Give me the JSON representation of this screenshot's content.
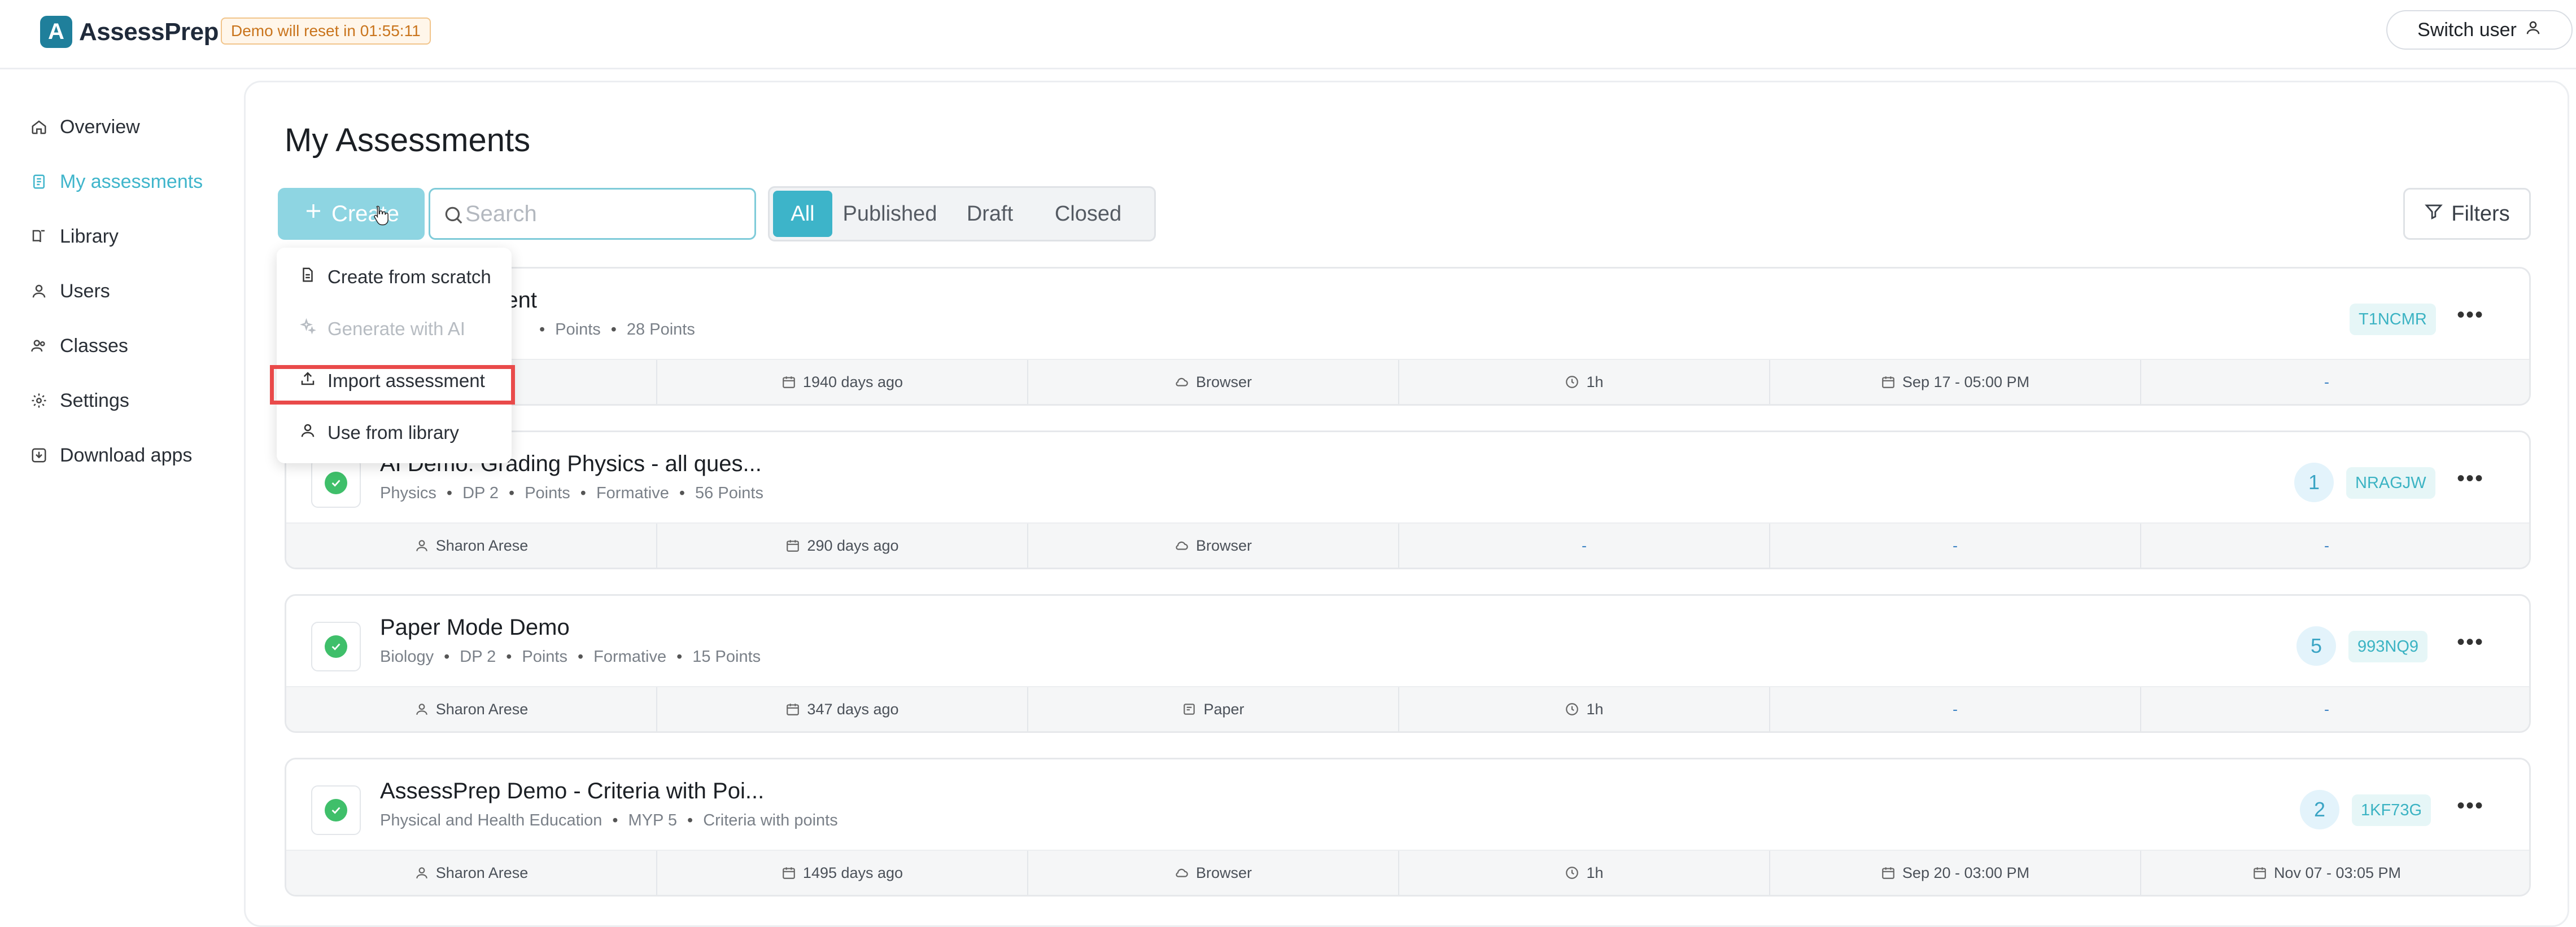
{
  "app": {
    "logo_mark": "A",
    "logo_text": "AssessPrep",
    "demo_badge": "Demo will reset in 01:55:11",
    "switch_user": "Switch user"
  },
  "sidebar": {
    "items": [
      {
        "label": "Overview",
        "icon": "home-icon"
      },
      {
        "label": "My assessments",
        "icon": "document-icon",
        "active": true
      },
      {
        "label": "Library",
        "icon": "book-icon"
      },
      {
        "label": "Users",
        "icon": "user-icon"
      },
      {
        "label": "Classes",
        "icon": "people-icon"
      },
      {
        "label": "Settings",
        "icon": "gear-icon"
      },
      {
        "label": "Download apps",
        "icon": "download-icon"
      }
    ]
  },
  "main": {
    "title": "My Assessments",
    "create_label": "Create",
    "search_placeholder": "Search",
    "tabs": [
      {
        "label": "All",
        "active": true
      },
      {
        "label": "Published"
      },
      {
        "label": "Draft"
      },
      {
        "label": "Closed"
      }
    ],
    "filters_label": "Filters"
  },
  "dropdown": {
    "items": [
      {
        "label": "Create from scratch",
        "icon": "file-icon"
      },
      {
        "label": "Generate with AI",
        "icon": "sparkle-icon",
        "disabled": true
      },
      {
        "label": "Import assessment",
        "icon": "upload-icon",
        "highlighted": true
      },
      {
        "label": "Use from library",
        "icon": "user-icon"
      }
    ]
  },
  "assessments": [
    {
      "title": "sment",
      "meta": [
        "Points",
        "28 Points"
      ],
      "count": "",
      "code": "T1NCMR",
      "footer": [
        "se",
        "1940 days ago",
        "Browser",
        "1h",
        "Sep 17 - 05:00 PM",
        "-"
      ]
    },
    {
      "title": "AI Demo: Grading Physics - all ques...",
      "meta": [
        "Physics",
        "DP 2",
        "Points",
        "Formative",
        "56 Points"
      ],
      "count": "1",
      "code": "NRAGJW",
      "footer": [
        "Sharon Arese",
        "290 days ago",
        "Browser",
        "-",
        "-",
        "-"
      ]
    },
    {
      "title": "Paper Mode Demo",
      "meta": [
        "Biology",
        "DP 2",
        "Points",
        "Formative",
        "15 Points"
      ],
      "count": "5",
      "code": "993NQ9",
      "footer": [
        "Sharon Arese",
        "347 days ago",
        "Paper",
        "1h",
        "-",
        "-"
      ]
    },
    {
      "title": "AssessPrep Demo - Criteria with Poi...",
      "meta": [
        "Physical and Health Education",
        "MYP 5",
        "Criteria with points"
      ],
      "count": "2",
      "code": "1KF73G",
      "footer": [
        "Sharon Arese",
        "1495 days ago",
        "Browser",
        "1h",
        "Sep 20 - 03:00 PM",
        "Nov 07 - 03:05 PM"
      ]
    }
  ],
  "colors": {
    "accent": "#3db4c9",
    "create_button": "#8ed5e2",
    "success": "#3fbf6a",
    "highlight": "#e94a4a"
  }
}
